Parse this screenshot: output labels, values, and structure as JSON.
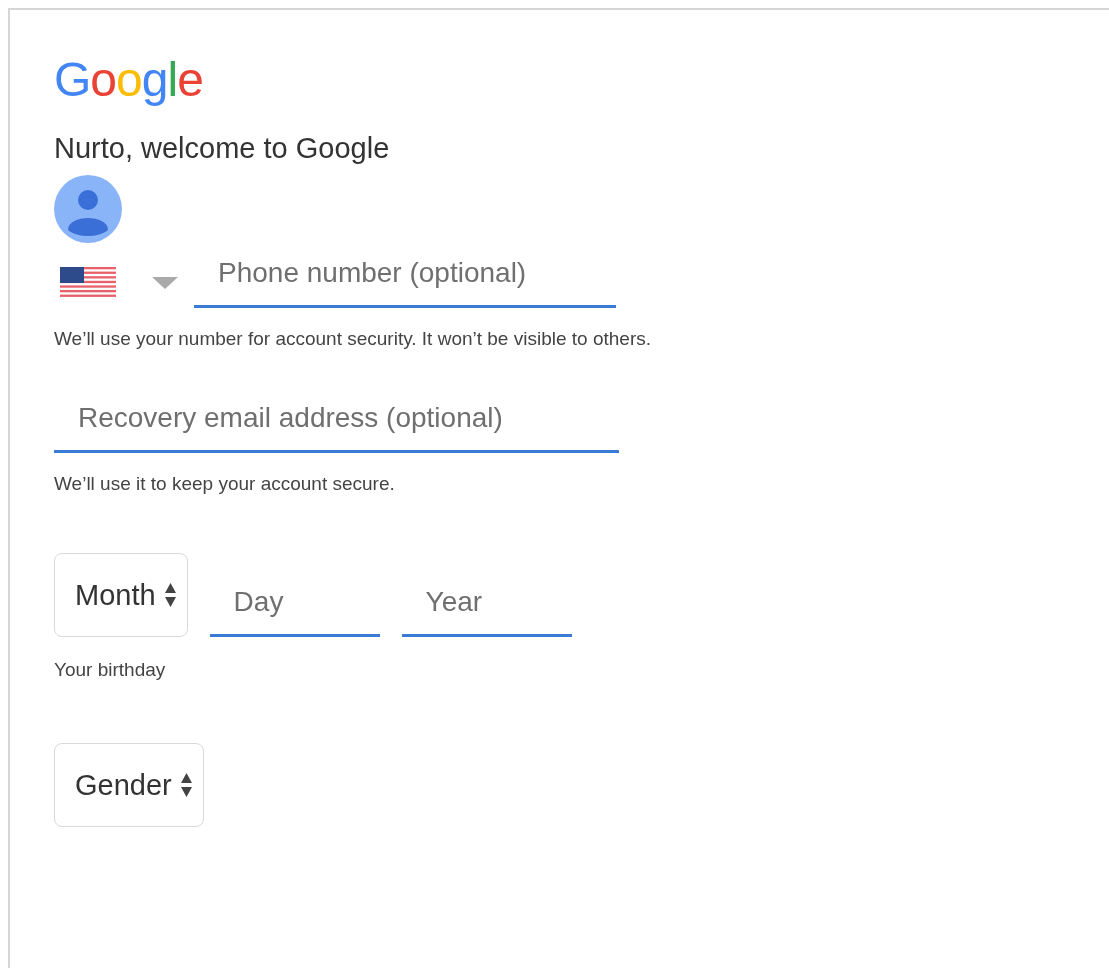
{
  "logo": "Google",
  "greeting": "Nurto, welcome to Google",
  "phone": {
    "placeholder": "Phone number (optional)",
    "hint": "We’ll use your number for account security. It won’t be visible to others."
  },
  "recovery_email": {
    "placeholder": "Recovery email address (optional)",
    "hint": "We’ll use it to keep your account secure."
  },
  "birthday": {
    "month": "Month",
    "day": {
      "placeholder": "Day"
    },
    "year": {
      "placeholder": "Year"
    },
    "hint": "Your birthday"
  },
  "gender": "Gender"
}
